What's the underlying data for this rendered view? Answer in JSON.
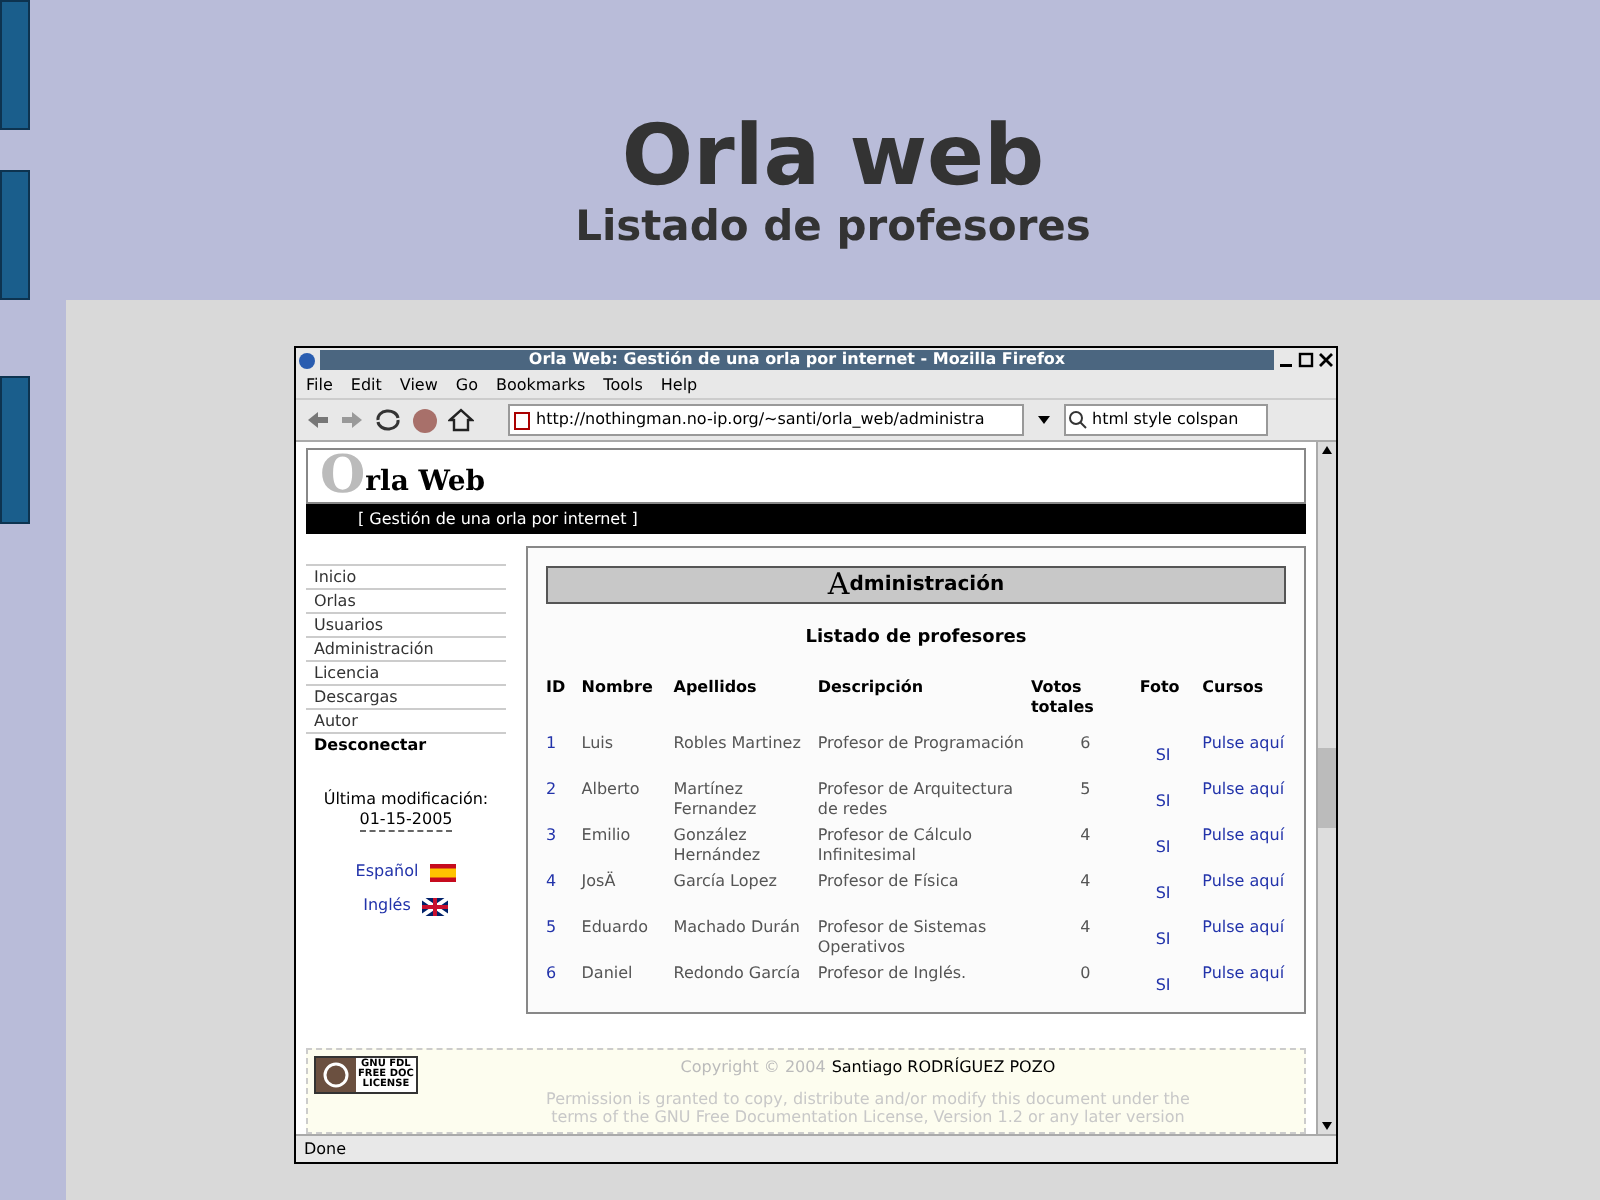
{
  "slide": {
    "title": "Orla web",
    "subtitle": "Listado de profesores"
  },
  "browser": {
    "title": "Orla Web: Gestión de una orla por internet - Mozilla Firefox",
    "menu": [
      "File",
      "Edit",
      "View",
      "Go",
      "Bookmarks",
      "Tools",
      "Help"
    ],
    "url": "http://nothingman.no-ip.org/~santi/orla_web/administra",
    "search": "html style colspan",
    "status": "Done"
  },
  "site": {
    "logo_initial": "O",
    "logo_rest": "rla Web",
    "tagline": "[ Gestión de una orla por internet ]",
    "nav": [
      {
        "label": "Inicio",
        "kind": "link"
      },
      {
        "label": "Orlas",
        "kind": "link"
      },
      {
        "label": "Usuarios",
        "kind": "link"
      },
      {
        "label": "Administración",
        "kind": "link"
      },
      {
        "label": "Licencia",
        "kind": "link"
      },
      {
        "label": "Descargas",
        "kind": "link"
      },
      {
        "label": "Autor",
        "kind": "link"
      },
      {
        "label": "Desconectar",
        "kind": "logout"
      }
    ],
    "modified_label": "Última modificación:",
    "modified_date": "01-15-2005",
    "languages": [
      {
        "label": "Español",
        "kind": "es"
      },
      {
        "label": "Inglés",
        "kind": "gb"
      }
    ]
  },
  "panel": {
    "initial": "A",
    "rest": "dministración",
    "heading": "Listado de profesores",
    "columns": [
      "ID",
      "Nombre",
      "Apellidos",
      "Descripción",
      "Votos totales",
      "Foto",
      "Cursos"
    ],
    "rows": [
      [
        "1",
        "Luis",
        "Robles Martinez",
        "Profesor de Programación",
        "6",
        "SI",
        "Pulse aquí"
      ],
      [
        "2",
        "Alberto",
        "Martínez Fernandez",
        "Profesor de Arquitectura de redes",
        "5",
        "SI",
        "Pulse aquí"
      ],
      [
        "3",
        "Emilio",
        "González Hernández",
        "Profesor de Cálculo Infinitesimal",
        "4",
        "SI",
        "Pulse aquí"
      ],
      [
        "4",
        "JosÄ",
        "García Lopez",
        "Profesor de Física",
        "4",
        "SI",
        "Pulse aquí"
      ],
      [
        "5",
        "Eduardo",
        "Machado Durán",
        "Profesor de Sistemas Operativos",
        "4",
        "SI",
        "Pulse aquí"
      ],
      [
        "6",
        "Daniel",
        "Redondo García",
        "Profesor de Inglés.",
        "0",
        "SI",
        "Pulse aquí"
      ]
    ]
  },
  "footer": {
    "badge": [
      "GNU FDL",
      "FREE DOC",
      "LICENSE"
    ],
    "copyright": "Copyright © 2004",
    "author": "Santiago RODRÍGUEZ POZO",
    "permission": [
      "Permission is granted to copy, distribute and/or modify this document under the",
      "terms of the GNU Free Documentation License, Version 1.2 or any later version"
    ]
  }
}
